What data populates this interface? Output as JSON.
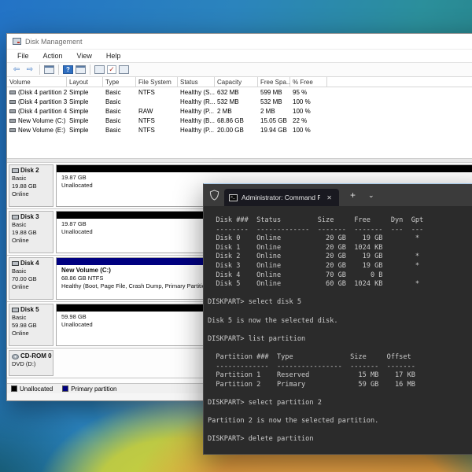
{
  "disk_management": {
    "title": "Disk Management",
    "menu": [
      "File",
      "Action",
      "View",
      "Help"
    ],
    "toolbar": {
      "back": "⇦",
      "forward": "⇨",
      "help": "?",
      "check": "✓"
    },
    "volume_table": {
      "columns": [
        "Volume",
        "Layout",
        "Type",
        "File System",
        "Status",
        "Capacity",
        "Free Spa...",
        "% Free"
      ],
      "rows": [
        {
          "volume": "(Disk 4 partition 2)",
          "layout": "Simple",
          "type": "Basic",
          "fs": "NTFS",
          "status": "Healthy (S...",
          "capacity": "632 MB",
          "free": "599 MB",
          "pct": "95 %"
        },
        {
          "volume": "(Disk 4 partition 3)",
          "layout": "Simple",
          "type": "Basic",
          "fs": "",
          "status": "Healthy (R...",
          "capacity": "532 MB",
          "free": "532 MB",
          "pct": "100 %"
        },
        {
          "volume": "(Disk 4 partition 4)",
          "layout": "Simple",
          "type": "Basic",
          "fs": "RAW",
          "status": "Healthy (P...",
          "capacity": "2 MB",
          "free": "2 MB",
          "pct": "100 %"
        },
        {
          "volume": "New Volume (C:)",
          "layout": "Simple",
          "type": "Basic",
          "fs": "NTFS",
          "status": "Healthy (B...",
          "capacity": "68.86 GB",
          "free": "15.05 GB",
          "pct": "22 %"
        },
        {
          "volume": "New Volume (E:)",
          "layout": "Simple",
          "type": "Basic",
          "fs": "NTFS",
          "status": "Healthy (P...",
          "capacity": "20.00 GB",
          "free": "19.94 GB",
          "pct": "100 %"
        }
      ]
    },
    "disks": [
      {
        "name": "Disk 2",
        "type": "Basic",
        "size": "19.88 GB",
        "status": "Online",
        "partition": {
          "line1": "19.87 GB",
          "line2": "Unallocated",
          "stripe": "#000000"
        }
      },
      {
        "name": "Disk 3",
        "type": "Basic",
        "size": "19.88 GB",
        "status": "Online",
        "partition": {
          "line1": "19.87 GB",
          "line2": "Unallocated",
          "stripe": "#000000"
        }
      },
      {
        "name": "Disk 4",
        "type": "Basic",
        "size": "70.00 GB",
        "status": "Online",
        "partition": {
          "title": "New Volume  (C:)",
          "line1": "68.86 GB NTFS",
          "line2": "Healthy (Boot, Page File, Crash Dump, Primary Partition)",
          "stripe": "#000080"
        }
      },
      {
        "name": "Disk 5",
        "type": "Basic",
        "size": "59.98 GB",
        "status": "Online",
        "partition": {
          "line1": "59.98 GB",
          "line2": "Unallocated",
          "stripe": "#000000"
        }
      }
    ],
    "cdrom": {
      "name": "CD-ROM 0",
      "line2": "DVD (D:)"
    },
    "legend": [
      {
        "label": "Unallocated",
        "color": "#000000"
      },
      {
        "label": "Primary partition",
        "color": "#000080"
      }
    ]
  },
  "terminal": {
    "tab_title": "Administrator: Command Pror",
    "close_glyph": "✕",
    "new_tab_glyph": "+",
    "dropdown_glyph": "⌄",
    "lines": [
      "  Disk ###  Status         Size     Free     Dyn  Gpt",
      "  --------  -------------  -------  -------  ---  ---",
      "  Disk 0    Online           20 GB    19 GB        *",
      "  Disk 1    Online           20 GB  1024 KB",
      "  Disk 2    Online           20 GB    19 GB        *",
      "  Disk 3    Online           20 GB    19 GB        *",
      "  Disk 4    Online           70 GB      0 B",
      "  Disk 5    Online           60 GB  1024 KB        *",
      "",
      "DISKPART> select disk 5",
      "",
      "Disk 5 is now the selected disk.",
      "",
      "DISKPART> list partition",
      "",
      "  Partition ###  Type              Size     Offset",
      "  -------------  ----------------  -------  -------",
      "  Partition 1    Reserved            15 MB    17 KB",
      "  Partition 2    Primary             59 GB    16 MB",
      "",
      "DISKPART> select partition 2",
      "",
      "Partition 2 is now the selected partition.",
      "",
      "DISKPART> delete partition"
    ]
  }
}
